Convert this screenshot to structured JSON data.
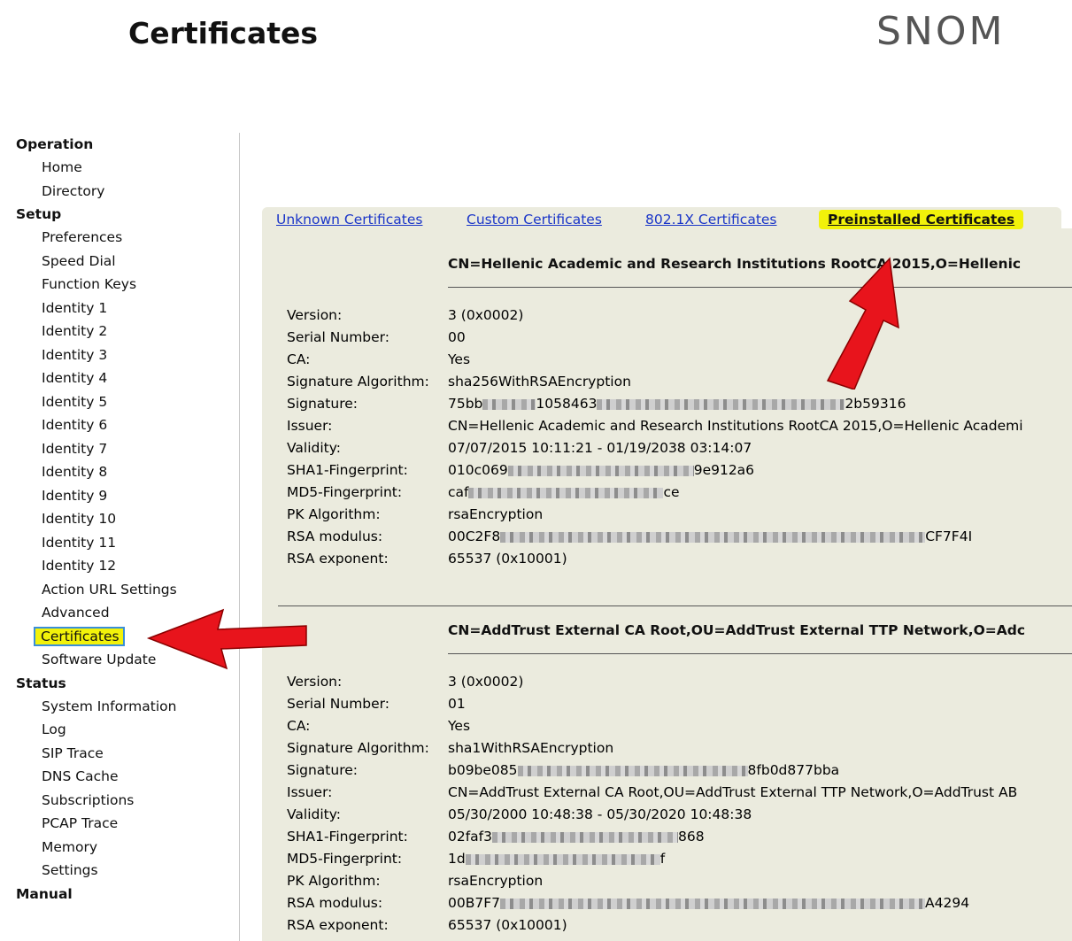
{
  "header": {
    "title": "Certificates",
    "brand": "SNOM"
  },
  "sidebar": {
    "sections": [
      {
        "label": "Operation",
        "items": [
          "Home",
          "Directory"
        ]
      },
      {
        "label": "Setup",
        "items": [
          "Preferences",
          "Speed Dial",
          "Function Keys",
          "Identity 1",
          "Identity 2",
          "Identity 3",
          "Identity 4",
          "Identity 5",
          "Identity 6",
          "Identity 7",
          "Identity 8",
          "Identity 9",
          "Identity 10",
          "Identity 11",
          "Identity 12",
          "Action URL Settings",
          "Advanced",
          "Certificates",
          "Software Update"
        ]
      },
      {
        "label": "Status",
        "items": [
          "System Information",
          "Log",
          "SIP Trace",
          "DNS Cache",
          "Subscriptions",
          "PCAP Trace",
          "Memory",
          "Settings"
        ]
      },
      {
        "label": "Manual",
        "items": []
      }
    ],
    "selected": "Certificates"
  },
  "tabs": [
    {
      "label": "Unknown Certificates"
    },
    {
      "label": "Custom Certificates"
    },
    {
      "label": "802.1X Certificates"
    },
    {
      "label": "Preinstalled Certificates",
      "active": true
    }
  ],
  "field_labels": [
    "Version:",
    "Serial Number:",
    "CA:",
    "Signature Algorithm:",
    "Signature:",
    "Issuer:",
    "Validity:",
    "SHA1-Fingerprint:",
    "MD5-Fingerprint:",
    "PK Algorithm:",
    "RSA modulus:",
    "RSA exponent:"
  ],
  "certificates": [
    {
      "title": "CN=Hellenic Academic and Research Institutions RootCA 2015,O=Hellenic",
      "version": "3 (0x0002)",
      "serial": "00",
      "ca": "Yes",
      "sig_alg": "sha256WithRSAEncryption",
      "signature_start": "75bb",
      "signature_mid": "1058463",
      "signature_end": "2b59316",
      "issuer": "CN=Hellenic Academic and Research Institutions RootCA 2015,O=Hellenic Academi",
      "validity": "07/07/2015 10:11:21 - 01/19/2038 03:14:07",
      "sha1_start": "010c069",
      "sha1_end": "9e912a6",
      "md5_start": "caf",
      "md5_end": "ce",
      "pk_alg": "rsaEncryption",
      "rsa_mod_start": "00C2F8",
      "rsa_mod_end": "CF7F4I",
      "rsa_exp": "65537 (0x10001)"
    },
    {
      "title": "CN=AddTrust External CA Root,OU=AddTrust External TTP Network,O=Adc",
      "version": "3 (0x0002)",
      "serial": "01",
      "ca": "Yes",
      "sig_alg": "sha1WithRSAEncryption",
      "signature_start": "b09be085",
      "signature_mid": "",
      "signature_end": "8fb0d877bba",
      "issuer": "CN=AddTrust External CA Root,OU=AddTrust External TTP Network,O=AddTrust AB",
      "validity": "05/30/2000 10:48:38 - 05/30/2020 10:48:38",
      "sha1_start": "02faf3",
      "sha1_end": "868",
      "md5_start": "1d",
      "md5_end": "f",
      "pk_alg": "rsaEncryption",
      "rsa_mod_start": "00B7F7",
      "rsa_mod_end": "A4294",
      "rsa_exp": "65537 (0x10001)"
    }
  ],
  "colors": {
    "panel": "#ebebde",
    "highlight": "#f2f20a",
    "link": "#1a35c8",
    "arrow": "#e8141c"
  }
}
